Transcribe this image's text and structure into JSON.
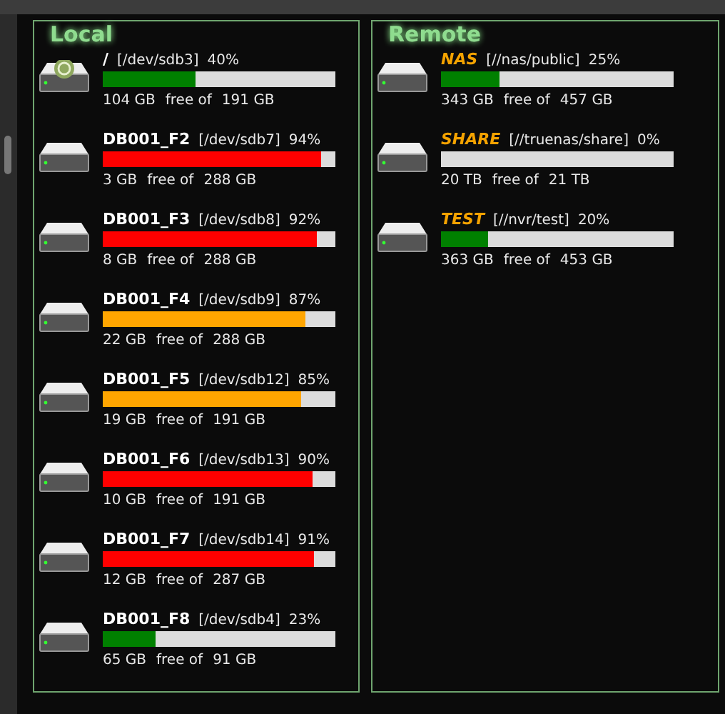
{
  "panels": [
    {
      "title": "Local",
      "kind": "local",
      "drives": [
        {
          "name": "/",
          "device": "[/dev/sdb3]",
          "percent": "40%",
          "level": 0.4,
          "color": "#008000",
          "emblem": true,
          "free": "104 GB",
          "free_label": "free of",
          "total": "191 GB"
        },
        {
          "name": "DB001_F2",
          "device": "[/dev/sdb7]",
          "percent": "94%",
          "level": 0.94,
          "color": "#ff0000",
          "emblem": false,
          "free": "3 GB",
          "free_label": "free of",
          "total": "288 GB"
        },
        {
          "name": "DB001_F3",
          "device": "[/dev/sdb8]",
          "percent": "92%",
          "level": 0.92,
          "color": "#ff0000",
          "emblem": false,
          "free": "8 GB",
          "free_label": "free of",
          "total": "288 GB"
        },
        {
          "name": "DB001_F4",
          "device": "[/dev/sdb9]",
          "percent": "87%",
          "level": 0.87,
          "color": "#ffa500",
          "emblem": false,
          "free": "22 GB",
          "free_label": "free of",
          "total": "288 GB"
        },
        {
          "name": "DB001_F5",
          "device": "[/dev/sdb12]",
          "percent": "85%",
          "level": 0.85,
          "color": "#ffa500",
          "emblem": false,
          "free": "19 GB",
          "free_label": "free of",
          "total": "191 GB"
        },
        {
          "name": "DB001_F6",
          "device": "[/dev/sdb13]",
          "percent": "90%",
          "level": 0.9,
          "color": "#ff0000",
          "emblem": false,
          "free": "10 GB",
          "free_label": "free of",
          "total": "191 GB"
        },
        {
          "name": "DB001_F7",
          "device": "[/dev/sdb14]",
          "percent": "91%",
          "level": 0.91,
          "color": "#ff0000",
          "emblem": false,
          "free": "12 GB",
          "free_label": "free of",
          "total": "287 GB"
        },
        {
          "name": "DB001_F8",
          "device": "[/dev/sdb4]",
          "percent": "23%",
          "level": 0.23,
          "color": "#008000",
          "emblem": false,
          "free": "65 GB",
          "free_label": "free of",
          "total": "91 GB"
        }
      ]
    },
    {
      "title": "Remote",
      "kind": "remote",
      "drives": [
        {
          "name": "NAS",
          "device": "[//nas/public]",
          "percent": "25%",
          "level": 0.25,
          "color": "#008000",
          "emblem": false,
          "free": "343 GB",
          "free_label": "free of",
          "total": "457 GB"
        },
        {
          "name": "SHARE",
          "device": "[//truenas/share]",
          "percent": "0%",
          "emblem": false,
          "free": "20 TB",
          "free_label": "free of",
          "total": "21 TB"
        },
        {
          "name": "TEST",
          "device": "[//nvr/test]",
          "percent": "20%",
          "level": 0.2,
          "color": "#008000",
          "emblem": false,
          "free": "363 GB",
          "free_label": "free of",
          "total": "453 GB"
        }
      ]
    }
  ]
}
